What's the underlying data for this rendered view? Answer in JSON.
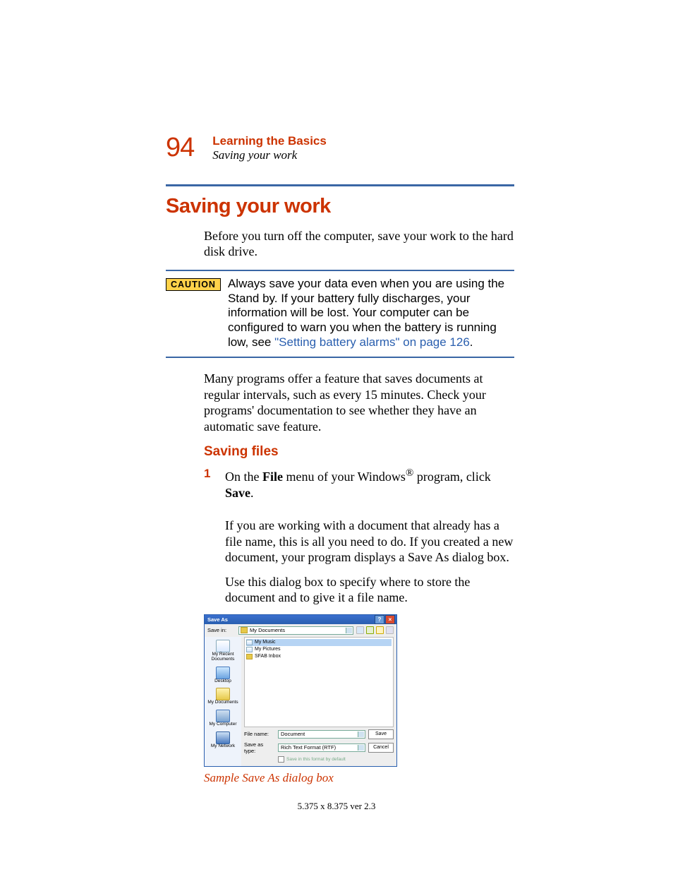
{
  "header": {
    "page_number": "94",
    "chapter": "Learning the Basics",
    "section": "Saving your work"
  },
  "h1": "Saving your work",
  "intro": "Before you turn off the computer, save your work to the hard disk drive.",
  "caution": {
    "badge": "CAUTION",
    "text_before_link": "Always save your data even when you are using the Stand by. If your battery fully discharges, your information will be lost. Your computer can be configured to warn you when the battery is running low, see ",
    "link": "\"Setting battery alarms\" on page 126",
    "text_after_link": "."
  },
  "para2": "Many programs offer a feature that saves documents at regular intervals, such as every 15 minutes. Check your programs' documentation to see whether they have an automatic save feature.",
  "h2": "Saving files",
  "step1": {
    "num": "1",
    "t1": "On the ",
    "b1": "File",
    "t2": " menu of your Windows",
    "sup": "®",
    "t3": " program, click ",
    "b2": "Save",
    "t4": "."
  },
  "step1_p2": "If you are working with a document that already has a file name, this is all you need to do. If you created a new document, your program displays a Save As dialog box.",
  "step1_p3": "Use this dialog box to specify where to store the document and to give it a file name.",
  "dialog": {
    "title": "Save As",
    "save_in_label": "Save in:",
    "save_in_value": "My Documents",
    "places": {
      "recent": "My Recent Documents",
      "desktop": "Desktop",
      "docs": "My Documents",
      "computer": "My Computer",
      "network": "My Network"
    },
    "file_items": {
      "a": "My Music",
      "b": "My Pictures",
      "c": "SFAB Inbox"
    },
    "filename_label": "File name:",
    "filename_value": "Document",
    "type_label": "Save as type:",
    "type_value": "Rich Text Format (RTF)",
    "save_btn": "Save",
    "cancel_btn": "Cancel",
    "default_check": "Save in this format by default"
  },
  "figure_caption": "Sample Save As dialog box",
  "footer": "5.375 x 8.375 ver 2.3"
}
